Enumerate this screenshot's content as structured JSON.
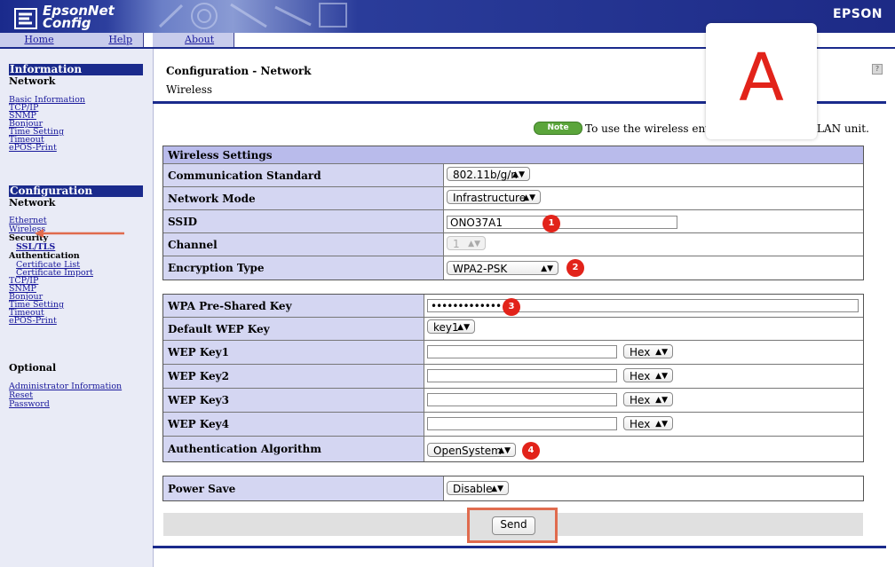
{
  "header": {
    "app_name_line1": "EpsonNet",
    "app_name_line2": "Config",
    "brand": "EPSON"
  },
  "nav": {
    "home": "Home",
    "help": "Help",
    "about": "About"
  },
  "sidebar": {
    "information": {
      "heading": "Information",
      "sub": "Network",
      "links": [
        "Basic Information",
        "TCP/IP",
        "SNMP",
        "Bonjour",
        "Time Setting",
        "Timeout",
        "ePOS-Print"
      ]
    },
    "configuration": {
      "heading": "Configuration",
      "sub": "Network",
      "ethernet": "Ethernet",
      "wireless": "Wireless",
      "security": "Security",
      "ssl_tls": "SSL/TLS",
      "authentication": "Authentication",
      "certificate_list": "Certificate List",
      "certificate_import": "Certificate Import",
      "tcpip": "TCP/IP",
      "snmp": "SNMP",
      "bonjour": "Bonjour",
      "time_setting": "Time Setting",
      "timeout": "Timeout",
      "epos_print": "ePOS-Print"
    },
    "optional": {
      "heading": "Optional",
      "links": [
        "Administrator Information",
        "Reset",
        "Password"
      ]
    }
  },
  "main": {
    "title": "Configuration - Network",
    "subtitle": "Wireless",
    "help_icon": "?",
    "note_badge": "Note",
    "note_text": "To use the wireless environ",
    "note_tail": "LAN unit.",
    "overlay_letter": "A"
  },
  "wireless_settings": {
    "header": "Wireless Settings",
    "communication_standard": {
      "label": "Communication Standard",
      "value": "802.11b/g/n"
    },
    "network_mode": {
      "label": "Network Mode",
      "value": "Infrastructure"
    },
    "ssid": {
      "label": "SSID",
      "value": "ONO37A1"
    },
    "channel": {
      "label": "Channel",
      "value": "1"
    },
    "encryption_type": {
      "label": "Encryption Type",
      "value": "WPA2-PSK"
    }
  },
  "security_keys": {
    "wpa_psk": {
      "label": "WPA Pre-Shared Key",
      "value": "•••••••••••••"
    },
    "default_wep": {
      "label": "Default WEP Key",
      "value": "key1"
    },
    "wep_key1": {
      "label": "WEP Key1",
      "format": "Hex"
    },
    "wep_key2": {
      "label": "WEP Key2",
      "format": "Hex"
    },
    "wep_key3": {
      "label": "WEP Key3",
      "format": "Hex"
    },
    "wep_key4": {
      "label": "WEP Key4",
      "format": "Hex"
    },
    "auth_algorithm": {
      "label": "Authentication Algorithm",
      "value": "OpenSystem"
    }
  },
  "power_save": {
    "label": "Power Save",
    "value": "Disable"
  },
  "send_label": "Send",
  "annotations": [
    "1",
    "2",
    "3",
    "4"
  ],
  "colors": {
    "navy": "#1a2a8c",
    "label_bg": "#d4d6f2",
    "header_bg": "#b9bbeb",
    "annotation_red": "#e2231a",
    "highlight": "#e06b4e"
  }
}
